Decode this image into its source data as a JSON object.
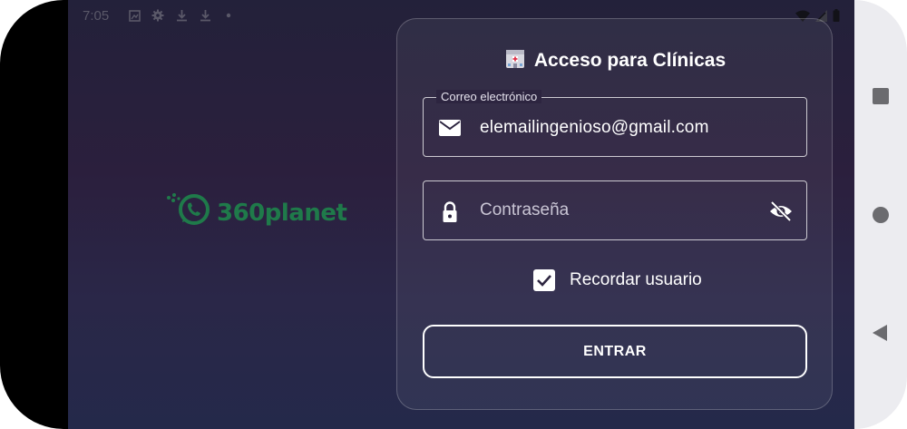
{
  "status_bar": {
    "time": "7:05",
    "left_icons": [
      "image-notification-icon",
      "settings-notification-icon",
      "download-icon",
      "download-icon",
      "dot-icon"
    ],
    "right_icons": [
      "wifi-icon",
      "signal-icon",
      "battery-icon"
    ]
  },
  "brand": {
    "name": "360planet",
    "color": "#1f7a4a"
  },
  "login": {
    "title": "Acceso para Clínicas",
    "title_icon": "hospital-icon",
    "email": {
      "label": "Correo electrónico",
      "value": "elemailingenioso@gmail.com",
      "icon": "mail-icon"
    },
    "password": {
      "placeholder": "Contraseña",
      "icon": "lock-icon",
      "toggle_icon": "visibility-off-icon"
    },
    "remember": {
      "label": "Recordar usuario",
      "checked": true
    },
    "submit_label": "ENTRAR"
  },
  "nav_bar": {
    "buttons": [
      "recents-button",
      "home-button",
      "back-button"
    ]
  }
}
